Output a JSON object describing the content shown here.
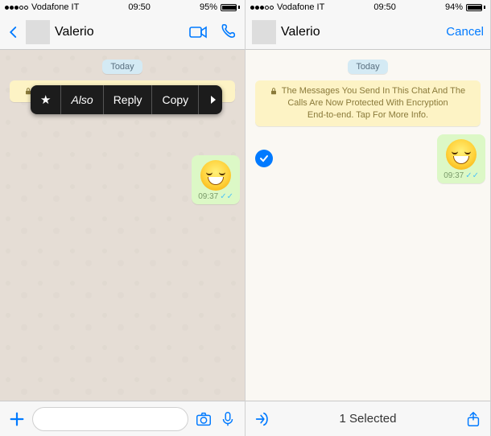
{
  "status": {
    "carrier": "Vodafone IT",
    "time": "09:50",
    "batteryLeft": "95%",
    "batteryRight": "94%"
  },
  "left": {
    "contact": "Valerio",
    "datePill": "Today",
    "encryption": "The Messages You Send In This Chat And The",
    "ctx": {
      "star": "★",
      "also": "Also",
      "reply": "Reply",
      "copy": "Copy"
    },
    "bubbleTime": "09:37"
  },
  "right": {
    "contact": "Valerio",
    "cancel": "Cancel",
    "datePill": "Today",
    "encryptionLine1": "The Messages You Send In This Chat And The",
    "encryptionLine2": "Calls Are Now Protected With Encryption",
    "encryptionLine3": "End-to-end. Tap For More Info.",
    "bubbleTime": "09:37",
    "selectedText": "1 Selected"
  }
}
